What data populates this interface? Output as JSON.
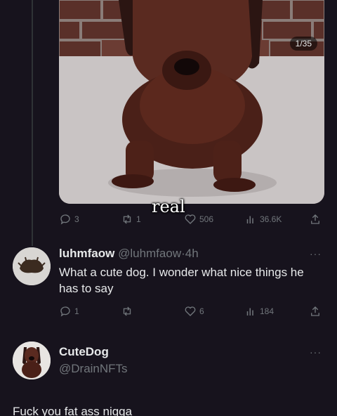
{
  "top_tweet": {
    "media_counter": "1/35",
    "actions": {
      "replies": "3",
      "retweets": "1",
      "likes": "506",
      "views": "36.6K"
    }
  },
  "overlay_caption": "real",
  "reply1": {
    "display_name": "luhmfaow",
    "handle": "@luhmfaow",
    "separator": "·",
    "time": "4h",
    "more": "···",
    "text": "What a cute dog. I wonder what nice things he has to say",
    "actions": {
      "replies": "1",
      "retweets": "",
      "likes": "6",
      "views": "184"
    }
  },
  "reply2": {
    "display_name": "CuteDog",
    "handle": "@DrainNFTs",
    "more": "···",
    "text": "Fuck you fat ass nigga"
  },
  "colors": {
    "background": "#17131d",
    "text": "#e7e9ea",
    "muted": "#71767b",
    "divider": "#2f3336"
  }
}
